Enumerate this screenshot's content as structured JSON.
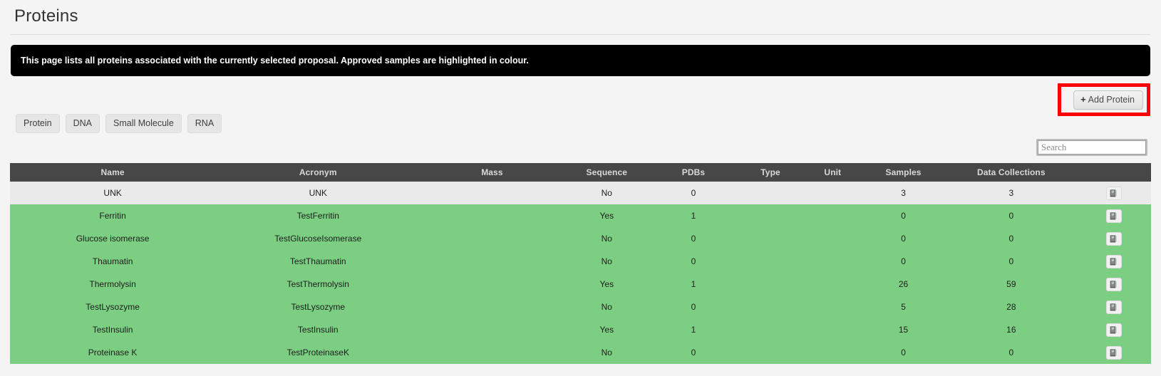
{
  "page": {
    "title": "Proteins",
    "alert": "This page lists all proteins associated with the currently selected proposal. Approved samples are highlighted in colour."
  },
  "actions": {
    "add_protein_label": "Add Protein",
    "add_protein_plus": "+",
    "highlight_color": "#fb0006"
  },
  "filters": [
    {
      "label": "Protein"
    },
    {
      "label": "DNA"
    },
    {
      "label": "Small Molecule"
    },
    {
      "label": "RNA"
    }
  ],
  "search": {
    "placeholder": "Search",
    "value": ""
  },
  "table": {
    "columns": [
      "Name",
      "Acronym",
      "Mass",
      "Sequence",
      "PDBs",
      "Type",
      "Unit",
      "Samples",
      "Data Collections",
      ""
    ],
    "action_icon": "book-icon",
    "rows": [
      {
        "name": "UNK",
        "acronym": "UNK",
        "mass": "",
        "sequence": "No",
        "pdbs": "0",
        "type": "",
        "unit": "",
        "samples": "3",
        "data_collections": "3",
        "approved": false
      },
      {
        "name": "Ferritin",
        "acronym": "TestFerritin",
        "mass": "",
        "sequence": "Yes",
        "pdbs": "1",
        "type": "",
        "unit": "",
        "samples": "0",
        "data_collections": "0",
        "approved": true
      },
      {
        "name": "Glucose isomerase",
        "acronym": "TestGlucoseIsomerase",
        "mass": "",
        "sequence": "No",
        "pdbs": "0",
        "type": "",
        "unit": "",
        "samples": "0",
        "data_collections": "0",
        "approved": true
      },
      {
        "name": "Thaumatin",
        "acronym": "TestThaumatin",
        "mass": "",
        "sequence": "No",
        "pdbs": "0",
        "type": "",
        "unit": "",
        "samples": "0",
        "data_collections": "0",
        "approved": true
      },
      {
        "name": "Thermolysin",
        "acronym": "TestThermolysin",
        "mass": "",
        "sequence": "Yes",
        "pdbs": "1",
        "type": "",
        "unit": "",
        "samples": "26",
        "data_collections": "59",
        "approved": true
      },
      {
        "name": "TestLysozyme",
        "acronym": "TestLysozyme",
        "mass": "",
        "sequence": "No",
        "pdbs": "0",
        "type": "",
        "unit": "",
        "samples": "5",
        "data_collections": "28",
        "approved": true
      },
      {
        "name": "TestInsulin",
        "acronym": "TestInsulin",
        "mass": "",
        "sequence": "Yes",
        "pdbs": "1",
        "type": "",
        "unit": "",
        "samples": "15",
        "data_collections": "16",
        "approved": true
      },
      {
        "name": "Proteinase K",
        "acronym": "TestProteinaseK",
        "mass": "",
        "sequence": "No",
        "pdbs": "0",
        "type": "",
        "unit": "",
        "samples": "0",
        "data_collections": "0",
        "approved": true
      }
    ]
  },
  "colors": {
    "approved_row": "#7ccf82",
    "plain_row": "#eaeaea",
    "header_bar": "#474747",
    "alert_bg": "#000000",
    "page_bg": "#f4f4f4"
  }
}
